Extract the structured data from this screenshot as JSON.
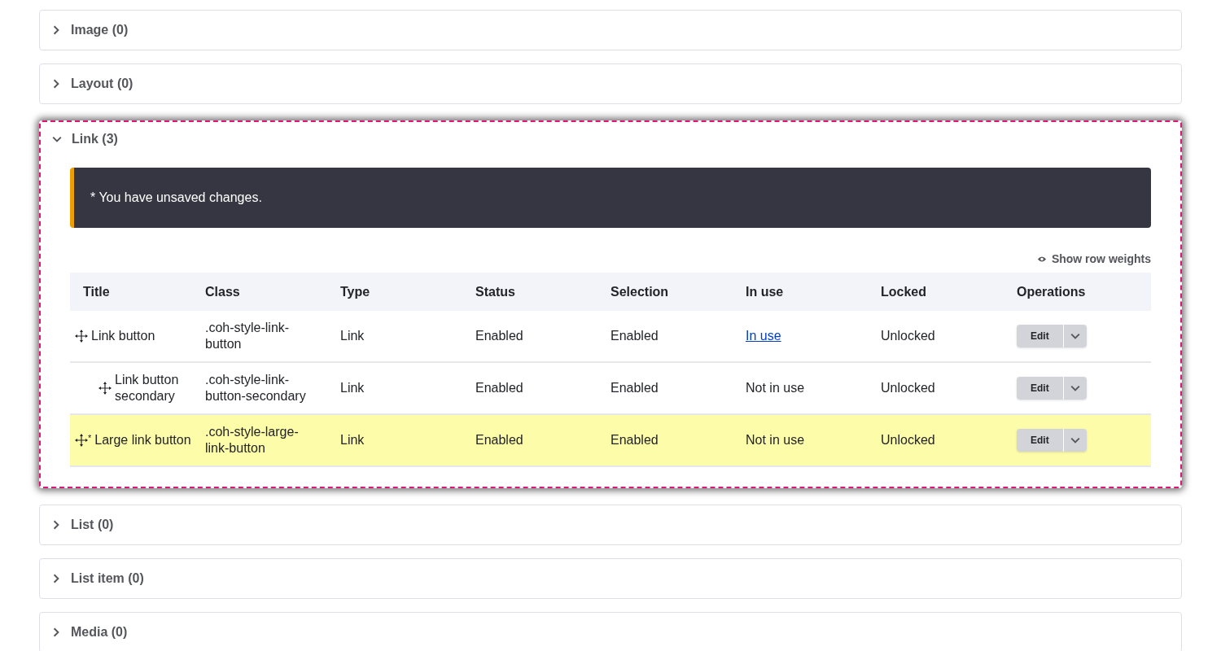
{
  "sections": [
    {
      "title": "Image (0)",
      "expanded": false
    },
    {
      "title": "Layout (0)",
      "expanded": false
    },
    {
      "title": "Link (3)",
      "expanded": true,
      "message": "* You have unsaved changes.",
      "weights_toggle": "Show row weights",
      "table": {
        "columns": [
          "Title",
          "Class",
          "Type",
          "Status",
          "Selection",
          "In use",
          "Locked",
          "Operations"
        ],
        "rows": [
          {
            "title": "Link button",
            "class": ".coh-style-link-button",
            "type": "Link",
            "status": "Enabled",
            "selection": "Enabled",
            "in_use": {
              "text": "In use",
              "kind": "link"
            },
            "locked": "Unlocked",
            "operation": "Edit",
            "changed": false,
            "children": [
              {
                "title": "Link button secondary",
                "class": ".coh-style-link-button-secondary",
                "type": "Link",
                "status": "Enabled",
                "selection": "Enabled",
                "in_use": {
                  "text": "Not in use",
                  "kind": "text"
                },
                "locked": "Unlocked",
                "operation": "Edit",
                "changed": false
              }
            ]
          },
          {
            "title": "Large link button",
            "class": ".coh-style-large-link-button",
            "type": "Link",
            "status": "Enabled",
            "selection": "Enabled",
            "in_use": {
              "text": "Not in use",
              "kind": "text"
            },
            "locked": "Unlocked",
            "operation": "Edit",
            "changed": true,
            "changed_mark": "*"
          }
        ]
      }
    },
    {
      "title": "List (0)",
      "expanded": false
    },
    {
      "title": "List item (0)",
      "expanded": false
    },
    {
      "title": "Media (0)",
      "expanded": false
    }
  ]
}
